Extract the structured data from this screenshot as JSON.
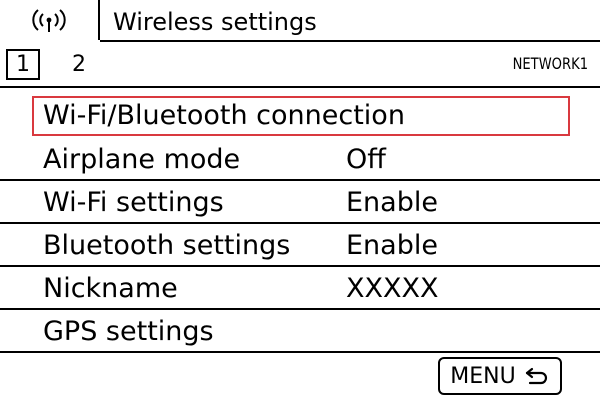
{
  "header": {
    "icon": "wireless-signal-icon",
    "title": "Wireless settings"
  },
  "pager": {
    "current_page": "1",
    "next_page": "2",
    "menu_id": "NETWORK1"
  },
  "menu": {
    "items": [
      {
        "label": "Wi-Fi/Bluetooth connection",
        "value": "",
        "selected": true
      },
      {
        "label": "Airplane mode",
        "value": "Off"
      },
      {
        "label": "Wi-Fi settings",
        "value": "Enable"
      },
      {
        "label": "Bluetooth settings",
        "value": "Enable"
      },
      {
        "label": "Nickname",
        "value": "XXXXX"
      },
      {
        "label": "GPS settings",
        "value": ""
      }
    ]
  },
  "footer": {
    "menu_button_label": "MENU",
    "return_icon": "return-arrow-icon"
  },
  "colors": {
    "selection": "#d9393f"
  }
}
